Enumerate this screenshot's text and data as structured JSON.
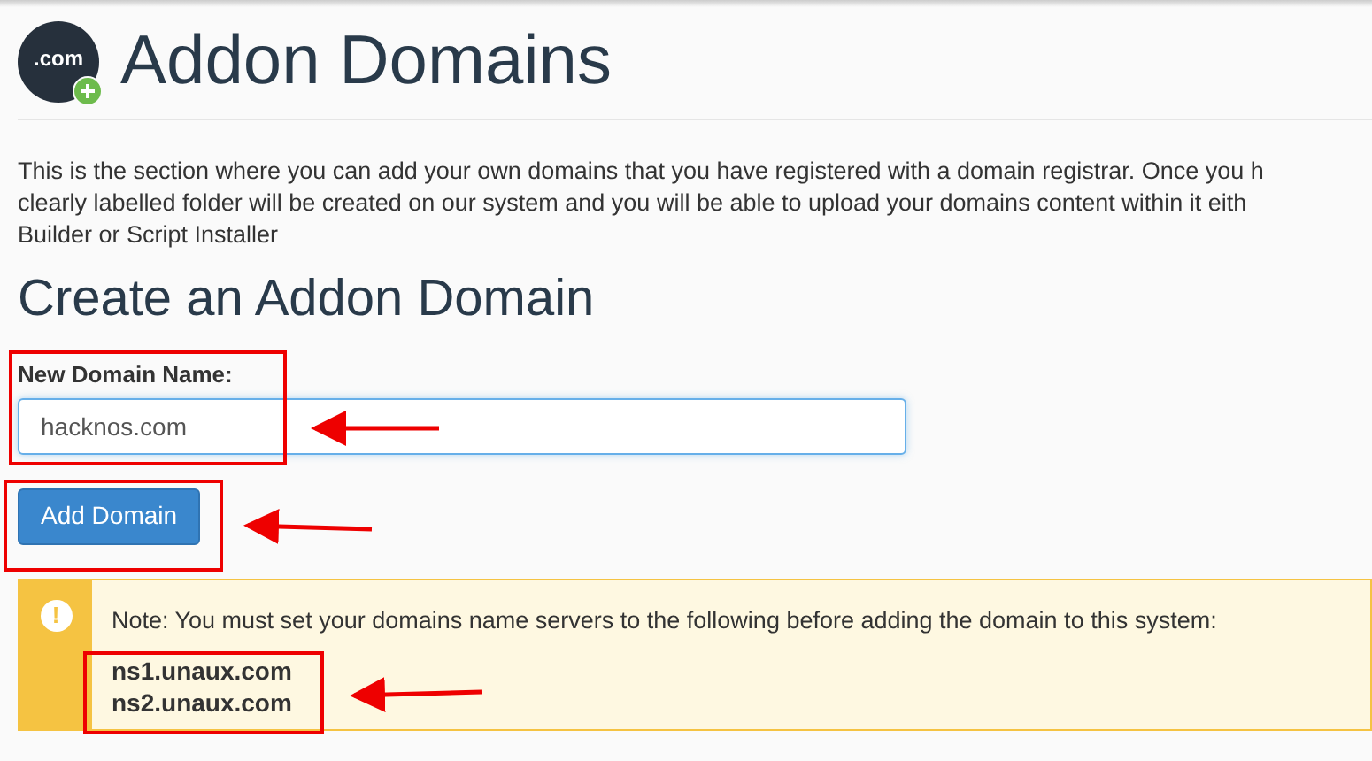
{
  "header": {
    "icon_text": ".com",
    "title": "Addon Domains"
  },
  "intro": [
    "This is the section where you can add your own domains that you have registered with a domain registrar. Once you h",
    "clearly labelled folder will be created on our system and you will be able to upload your domains content within it eith",
    "Builder or Script Installer"
  ],
  "form": {
    "heading": "Create an Addon Domain",
    "label": "New Domain Name:",
    "value": "hacknos.com",
    "button": "Add Domain"
  },
  "alert": {
    "icon": "!",
    "note": "Note: You must set your domains name servers to the following before adding the domain to this system:",
    "servers": [
      "ns1.unaux.com",
      "ns2.unaux.com"
    ]
  }
}
